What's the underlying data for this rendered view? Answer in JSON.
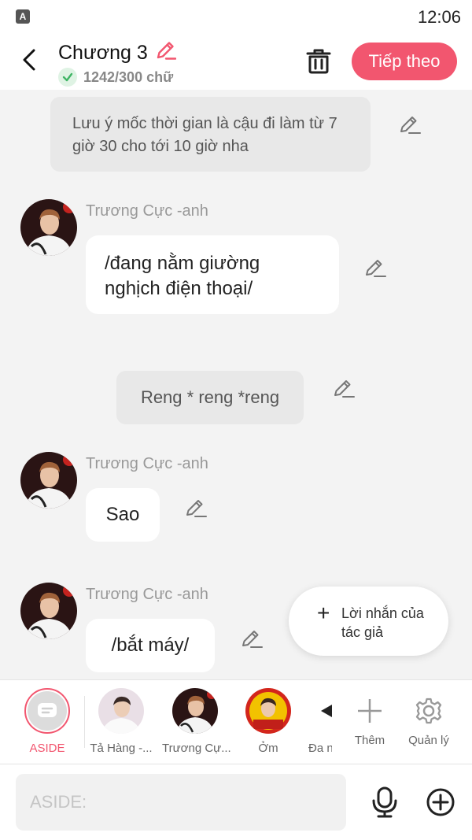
{
  "status_bar": {
    "time": "12:06",
    "indicator": "A"
  },
  "header": {
    "chapter_title": "Chương 3",
    "word_count": "1242/300 chữ",
    "next_label": "Tiếp theo"
  },
  "messages": [
    {
      "type": "narration",
      "text": "Lưu ý mốc thời gian là cậu đi làm từ 7 giờ 30 cho tới 10 giờ nha"
    },
    {
      "type": "character",
      "speaker": "Trương Cực -anh",
      "text": "/đang nằm giường nghịch điện thoại/"
    },
    {
      "type": "narration",
      "text": "Reng * reng *reng"
    },
    {
      "type": "character",
      "speaker": "Trương Cực -anh",
      "text": "Sao"
    },
    {
      "type": "character",
      "speaker": "Trương Cực -anh",
      "text": "/bắt máy/"
    }
  ],
  "author_note": {
    "label": "Lời nhắn của tác giả"
  },
  "characters": {
    "aside": "ASIDE",
    "items": [
      "Tả Hàng -...",
      "Trương Cự...",
      "Ởm",
      "Đa n"
    ],
    "more_label": "Thêm",
    "manage_label": "Quản lý"
  },
  "input": {
    "placeholder": "ASIDE:"
  },
  "colors": {
    "accent": "#f2566f",
    "background": "#f3f3f3",
    "bubble": "#ffffff",
    "narration": "#e8e8e8"
  },
  "icons": [
    "back-arrow-icon",
    "pencil-icon",
    "check-icon",
    "trash-icon",
    "plus-icon",
    "gear-icon",
    "microphone-icon",
    "add-circle-icon",
    "chat-bubble-icon"
  ]
}
